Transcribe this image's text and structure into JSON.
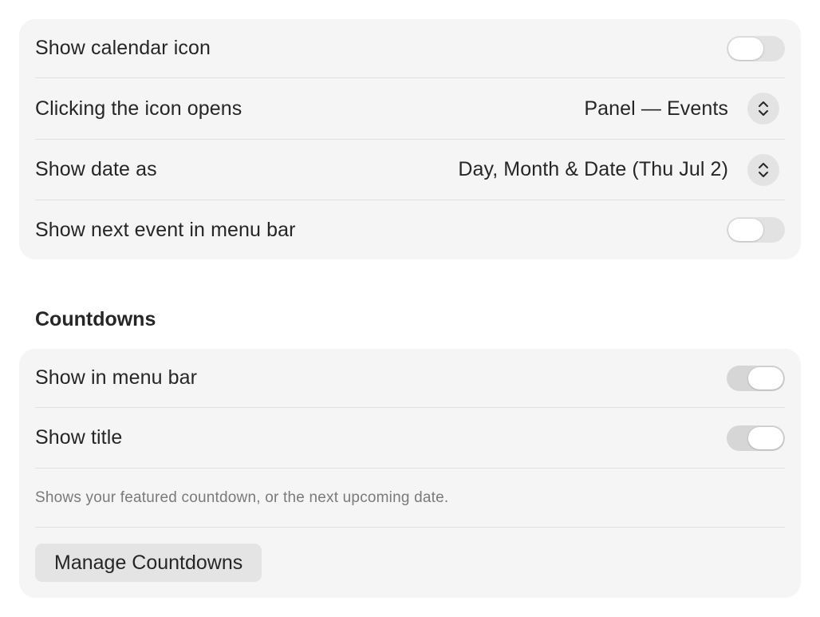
{
  "menu_bar": {
    "show_calendar_icon": {
      "label": "Show calendar icon",
      "on": false
    },
    "clicking_icon_opens": {
      "label": "Clicking the icon opens",
      "value": "Panel — Events",
      "icon": "chevron-up-down-icon"
    },
    "show_date_as": {
      "label": "Show date as",
      "value": "Day, Month & Date (Thu Jul 2)",
      "icon": "chevron-up-down-icon"
    },
    "show_next_event": {
      "label": "Show next event in menu bar",
      "on": false
    }
  },
  "countdowns": {
    "title": "Countdowns",
    "show_in_menu_bar": {
      "label": "Show in menu bar",
      "on": true
    },
    "show_title": {
      "label": "Show title",
      "on": true
    },
    "caption": "Shows your featured countdown, or the next upcoming date.",
    "manage_button": "Manage Countdowns"
  },
  "colors": {
    "group_background": "#f5f5f5",
    "toggle_off": "#e2e2e2",
    "toggle_on": "#d6d6d6",
    "text": "#262626",
    "caption": "#7a7a7a"
  }
}
